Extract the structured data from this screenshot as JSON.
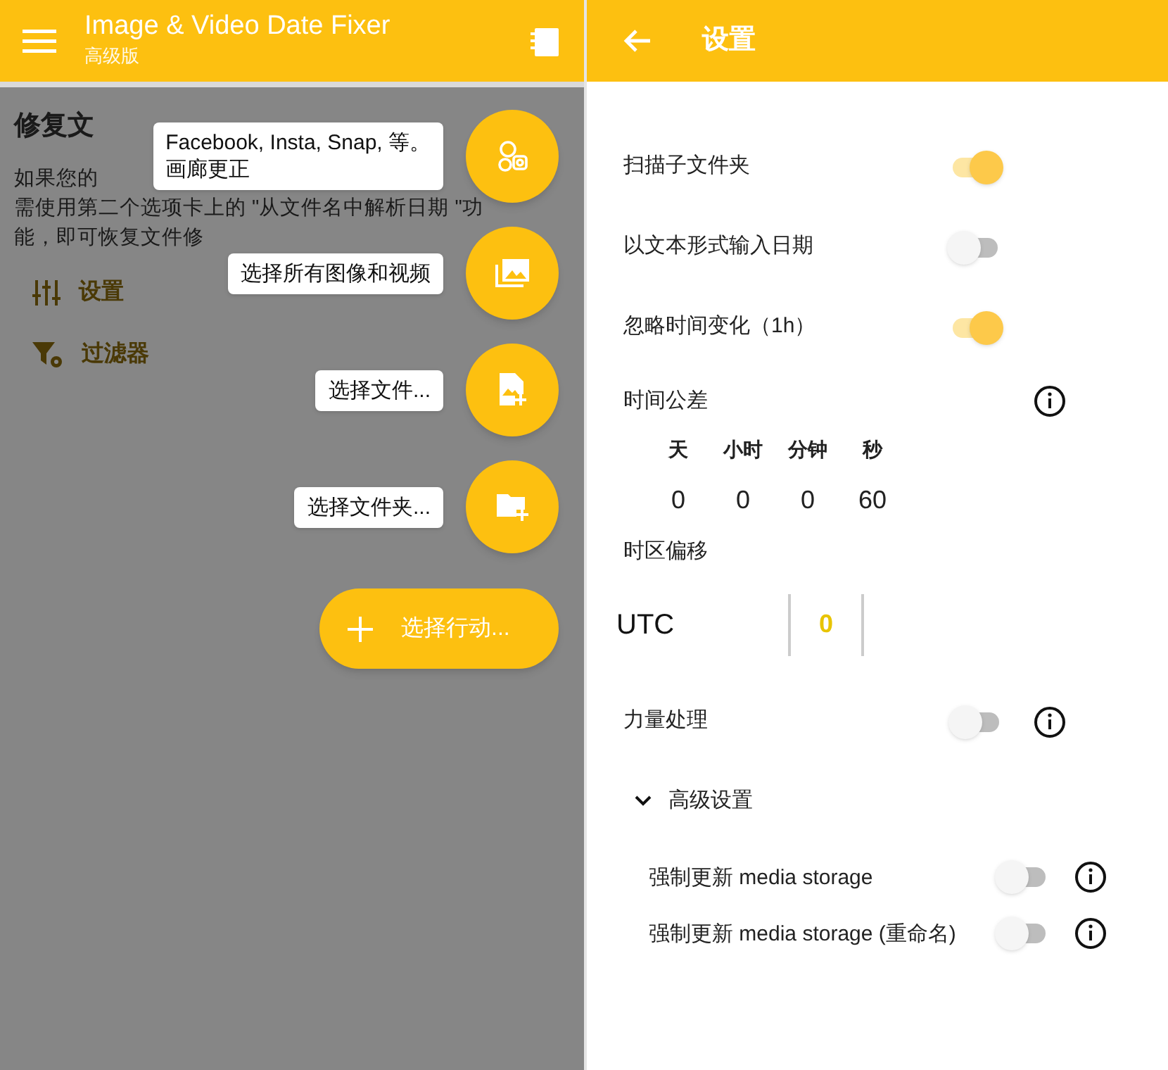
{
  "left": {
    "toolbar": {
      "title": "Image & Video Date Fixer",
      "subtitle": "高级版"
    },
    "heading": "修复文",
    "description_lines": [
      "如果您的",
      "需使用第二个选项卡上的 \"从文件名中解析日期 \"功",
      "能，即可恢复文件修"
    ],
    "menu": [
      {
        "kind": "settings",
        "label": "设置"
      },
      {
        "kind": "filter",
        "label": "过滤器"
      }
    ],
    "fab_actions": [
      {
        "kind": "social",
        "lines": [
          "Facebook, Insta, Snap, 等。",
          "画廊更正"
        ]
      },
      {
        "kind": "gallery",
        "lines": [
          "选择所有图像和视频"
        ]
      },
      {
        "kind": "file",
        "lines": [
          "选择文件..."
        ]
      },
      {
        "kind": "folder",
        "lines": [
          "选择文件夹..."
        ]
      }
    ],
    "main_fab": {
      "label": "选择行动..."
    }
  },
  "right": {
    "toolbar": {
      "title": "设置"
    },
    "switches": [
      {
        "label": "扫描子文件夹",
        "on": true
      },
      {
        "label": "以文本形式输入日期",
        "on": false
      },
      {
        "label": "忽略时间变化（1h）",
        "on": true
      }
    ],
    "tolerance": {
      "label": "时间公差",
      "units": [
        {
          "label": "天",
          "value": "0"
        },
        {
          "label": "小时",
          "value": "0"
        },
        {
          "label": "分钟",
          "value": "0"
        },
        {
          "label": "秒",
          "value": "60"
        }
      ]
    },
    "timezone": {
      "label": "时区偏移",
      "prefix": "UTC",
      "value": "0"
    },
    "force": {
      "label": "力量处理",
      "on": false
    },
    "advanced": {
      "label": "高级设置",
      "expanded": true,
      "items": [
        {
          "label": "强制更新 media storage",
          "on": false
        },
        {
          "label": "强制更新 media storage (重命名)",
          "on": false
        }
      ]
    }
  }
}
